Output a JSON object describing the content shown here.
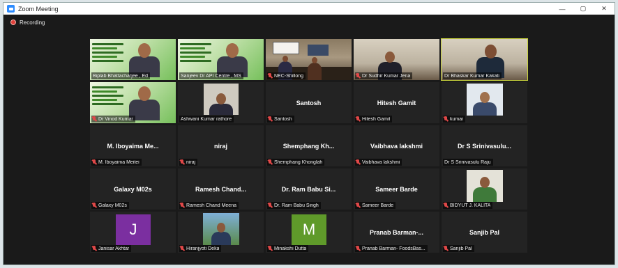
{
  "window": {
    "title": "Zoom Meeting",
    "controls": {
      "minimize": "—",
      "maximize": "▢",
      "close": "✕"
    }
  },
  "recording": {
    "label": "Recording"
  },
  "colors": {
    "active_speaker_border": "#c8d23c",
    "muted_icon": "#e04848",
    "recording_dot": "#e0403a"
  },
  "participants": [
    {
      "label": "Biplab Bhattacharjee , Ed",
      "display": "",
      "type": "video-banner",
      "muted": false
    },
    {
      "label": "Sanjeev Dr API Centre , MS",
      "display": "",
      "type": "video-banner",
      "muted": false
    },
    {
      "label": "NEC-Shillong",
      "display": "",
      "type": "video-conference",
      "muted": true
    },
    {
      "label": "Dr Sudhir Kumar Jena",
      "display": "",
      "type": "video-office",
      "muted": true
    },
    {
      "label": "Dr Bhaskar Kumar Kakati",
      "display": "",
      "type": "video-office-active",
      "muted": false
    },
    {
      "label": "Dr Vinod Kumar",
      "display": "",
      "type": "video-banner",
      "muted": true
    },
    {
      "label": "Ashwani Kumar rathore",
      "display": "",
      "type": "video-small",
      "muted": false
    },
    {
      "label": "Santosh",
      "display": "Santosh",
      "type": "name",
      "muted": true
    },
    {
      "label": "Hitesh Gamit",
      "display": "Hitesh Gamit",
      "type": "name",
      "muted": true
    },
    {
      "label": "kumar",
      "display": "",
      "type": "video-small2",
      "muted": true
    },
    {
      "label": "M. Iboyaima Meitei",
      "display": "M. Iboyaima Me...",
      "type": "name",
      "muted": true
    },
    {
      "label": "niraj",
      "display": "niraj",
      "type": "name",
      "muted": true
    },
    {
      "label": "Shemphang Khonglah",
      "display": "Shemphang Kh...",
      "type": "name",
      "muted": true
    },
    {
      "label": "Vaibhava lakshmi",
      "display": "Vaibhava lakshmi",
      "type": "name",
      "muted": true
    },
    {
      "label": "Dr S Srinivasulu Raju",
      "display": "Dr S Srinivasulu...",
      "type": "name",
      "muted": false
    },
    {
      "label": "Galaxy M02s",
      "display": "Galaxy M02s",
      "type": "name",
      "muted": true
    },
    {
      "label": "Ramesh Chand Meena",
      "display": "Ramesh Chand...",
      "type": "name",
      "muted": true
    },
    {
      "label": "Dr. Ram Babu Singh",
      "display": "Dr. Ram Babu Si...",
      "type": "name",
      "muted": true
    },
    {
      "label": "Sameer Barde",
      "display": "Sameer Barde",
      "type": "name",
      "muted": true
    },
    {
      "label": "BIDYUT J. KALITA",
      "display": "",
      "type": "video-small3",
      "muted": true
    },
    {
      "label": "Janisar Akhtar",
      "display": "",
      "type": "avatar",
      "letter": "J",
      "avatar_color": "#7b2fa0",
      "muted": true
    },
    {
      "label": "Hiranjyoti Deka",
      "display": "",
      "type": "video-small4",
      "muted": true
    },
    {
      "label": "Minakshi Dutta",
      "display": "",
      "type": "avatar",
      "letter": "M",
      "avatar_color": "#5f9a2a",
      "muted": true
    },
    {
      "label": "Pranab Barman- FoodsBas...",
      "display": "Pranab Barman-...",
      "type": "name",
      "muted": true
    },
    {
      "label": "Sanjib Pal",
      "display": "Sanjib Pal",
      "type": "name",
      "muted": true
    }
  ]
}
